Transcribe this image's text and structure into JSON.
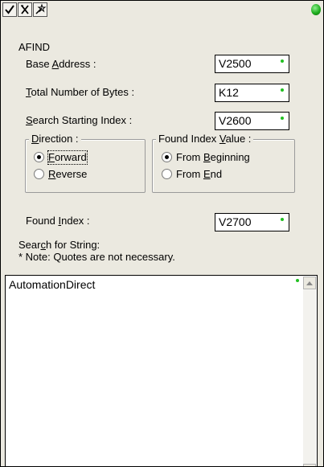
{
  "toolbar": {
    "icons": [
      "checkmark-icon",
      "cancel-icon",
      "wizard-icon"
    ],
    "status_color": "#1fae1f"
  },
  "form": {
    "instruction_name": "AFIND",
    "base_address": {
      "label_pre": "Base ",
      "label_key": "A",
      "label_post": "ddress :",
      "value": "V2500"
    },
    "total_bytes": {
      "label_pre": "",
      "label_key": "T",
      "label_post": "otal Number of Bytes :",
      "value": "K12"
    },
    "search_start": {
      "label_pre": "",
      "label_key": "S",
      "label_post": "earch Starting Index :",
      "value": "V2600"
    },
    "direction": {
      "legend_pre": "",
      "legend_key": "D",
      "legend_post": "irection :",
      "options": [
        {
          "pre": "",
          "key": "F",
          "post": "orward",
          "checked": true
        },
        {
          "pre": "",
          "key": "R",
          "post": "everse",
          "checked": false
        }
      ]
    },
    "found_index_value": {
      "legend_pre": "Found Index ",
      "legend_key": "V",
      "legend_post": "alue :",
      "options": [
        {
          "pre": "From ",
          "key": "B",
          "post": "eginning",
          "checked": true
        },
        {
          "pre": "From ",
          "key": "E",
          "post": "nd",
          "checked": false
        }
      ]
    },
    "found_index": {
      "label_pre": "Found ",
      "label_key": "I",
      "label_post": "ndex :",
      "value": "V2700"
    },
    "search_string": {
      "label_pre": "Sear",
      "label_key": "c",
      "label_post": "h for String:",
      "note": "* Note: Quotes are not necessary.",
      "value": "AutomationDirect"
    }
  },
  "colors": {
    "valid_dot": "#22c022",
    "panel_bg": "#ebe9e0"
  }
}
